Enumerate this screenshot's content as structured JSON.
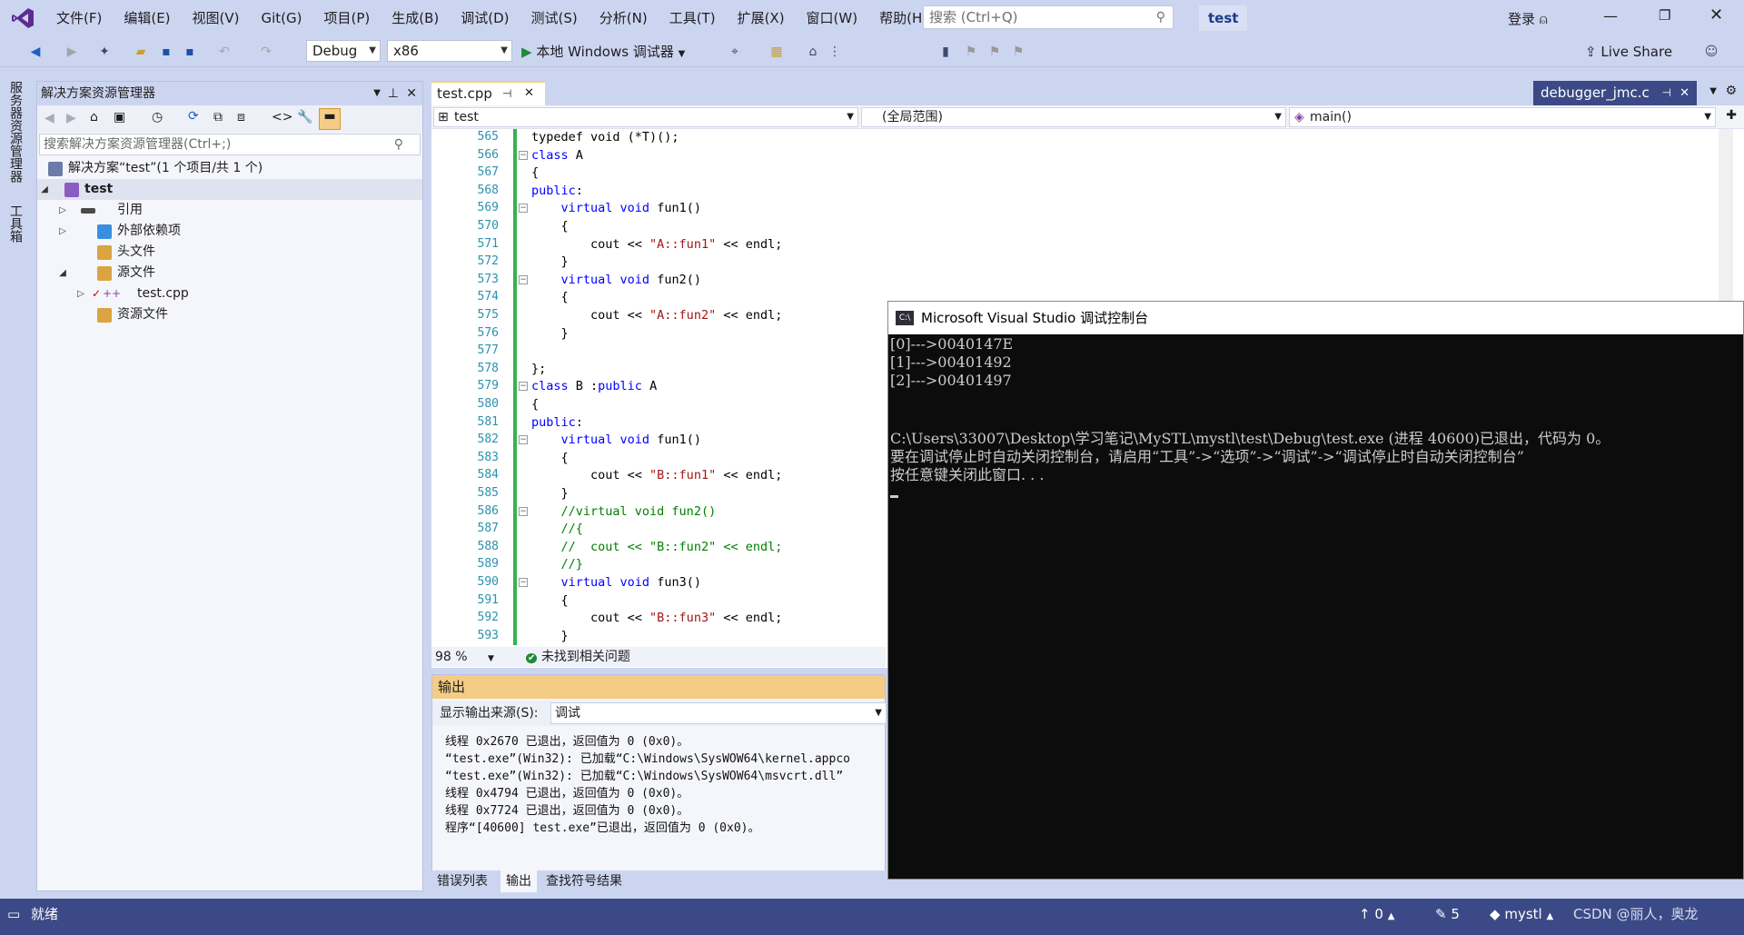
{
  "menu": [
    "文件(F)",
    "编辑(E)",
    "视图(V)",
    "Git(G)",
    "项目(P)",
    "生成(B)",
    "调试(D)",
    "测试(S)",
    "分析(N)",
    "工具(T)",
    "扩展(X)",
    "窗口(W)",
    "帮助(H)"
  ],
  "search_placeholder": "搜索 (Ctrl+Q)",
  "project_badge": "test",
  "login": "登录",
  "toolbar": {
    "config": "Debug",
    "platform": "x86",
    "run_label": "本地 Windows 调试器",
    "live_share": "Live Share"
  },
  "leftstrip": {
    "tab1": "服务器资源管理器",
    "tab2": "工具箱"
  },
  "solution": {
    "title": "解决方案资源管理器",
    "search_placeholder": "搜索解决方案资源管理器(Ctrl+;)",
    "root": "解决方案“test”(1 个项目/共 1 个)",
    "project": "test",
    "items": [
      "引用",
      "外部依赖项",
      "头文件",
      "源文件",
      "test.cpp",
      "资源文件"
    ]
  },
  "editor": {
    "tab": "test.cpp",
    "right_tab": "debugger_jmc.c",
    "nav_project": "test",
    "nav_scope": "(全局范围)",
    "nav_member": "main()",
    "zoom": "98 %",
    "issues": "未找到相关问题",
    "line_numbers": [
      "565",
      "566",
      "567",
      "568",
      "569",
      "570",
      "571",
      "572",
      "573",
      "574",
      "575",
      "576",
      "577",
      "578",
      "579",
      "580",
      "581",
      "582",
      "583",
      "584",
      "585",
      "586",
      "587",
      "588",
      "589",
      "590",
      "591",
      "592",
      "593"
    ]
  },
  "code": [
    [
      [
        "p",
        "typedef void (*T)();"
      ]
    ],
    [
      [
        "k",
        "class"
      ],
      [
        "p",
        " A"
      ]
    ],
    [
      [
        "p",
        "{"
      ]
    ],
    [
      [
        "k",
        "public"
      ],
      [
        "p",
        ":"
      ]
    ],
    [
      [
        "p",
        "    "
      ],
      [
        "k",
        "virtual void"
      ],
      [
        "p",
        " fun1()"
      ]
    ],
    [
      [
        "p",
        "    {"
      ]
    ],
    [
      [
        "p",
        "        cout << "
      ],
      [
        "s",
        "\"A::fun1\""
      ],
      [
        "p",
        " << endl;"
      ]
    ],
    [
      [
        "p",
        "    }"
      ]
    ],
    [
      [
        "p",
        "    "
      ],
      [
        "k",
        "virtual void"
      ],
      [
        "p",
        " fun2()"
      ]
    ],
    [
      [
        "p",
        "    {"
      ]
    ],
    [
      [
        "p",
        "        cout << "
      ],
      [
        "s",
        "\"A::fun2\""
      ],
      [
        "p",
        " << endl;"
      ]
    ],
    [
      [
        "p",
        "    }"
      ]
    ],
    [
      [
        "p",
        ""
      ]
    ],
    [
      [
        "p",
        "};"
      ]
    ],
    [
      [
        "k",
        "class"
      ],
      [
        "p",
        " B :"
      ],
      [
        "k",
        "public"
      ],
      [
        "p",
        " A"
      ]
    ],
    [
      [
        "p",
        "{"
      ]
    ],
    [
      [
        "k",
        "public"
      ],
      [
        "p",
        ":"
      ]
    ],
    [
      [
        "p",
        "    "
      ],
      [
        "k",
        "virtual void"
      ],
      [
        "p",
        " fun1()"
      ]
    ],
    [
      [
        "p",
        "    {"
      ]
    ],
    [
      [
        "p",
        "        cout << "
      ],
      [
        "s",
        "\"B::fun1\""
      ],
      [
        "p",
        " << endl;"
      ]
    ],
    [
      [
        "p",
        "    }"
      ]
    ],
    [
      [
        "p",
        "    "
      ],
      [
        "c",
        "//virtual void fun2()"
      ]
    ],
    [
      [
        "p",
        "    "
      ],
      [
        "c",
        "//{"
      ]
    ],
    [
      [
        "p",
        "    "
      ],
      [
        "c",
        "//  cout << \"B::fun2\" << endl;"
      ]
    ],
    [
      [
        "p",
        "    "
      ],
      [
        "c",
        "//}"
      ]
    ],
    [
      [
        "p",
        "    "
      ],
      [
        "k",
        "virtual void"
      ],
      [
        "p",
        " fun3()"
      ]
    ],
    [
      [
        "p",
        "    {"
      ]
    ],
    [
      [
        "p",
        "        cout << "
      ],
      [
        "s",
        "\"B::fun3\""
      ],
      [
        "p",
        " << endl;"
      ]
    ],
    [
      [
        "p",
        "    }"
      ]
    ]
  ],
  "output": {
    "title": "输出",
    "source_label": "显示输出来源(S):",
    "source_value": "调试",
    "lines": [
      "线程 0x2670 已退出，返回值为 0 (0x0)。",
      "“test.exe”(Win32): 已加载“C:\\Windows\\SysWOW64\\kernel.appco",
      "“test.exe”(Win32): 已加载“C:\\Windows\\SysWOW64\\msvcrt.dll”",
      "线程 0x4794 已退出，返回值为 0 (0x0)。",
      "线程 0x7724 已退出，返回值为 0 (0x0)。",
      "程序“[40600] test.exe”已退出，返回值为 0 (0x0)。"
    ],
    "tabs": [
      "错误列表",
      "输出",
      "查找符号结果"
    ]
  },
  "console": {
    "title": "Microsoft Visual Studio 调试控制台",
    "lines": [
      "[0]--->0040147E",
      "[1]--->00401492",
      "[2]--->00401497",
      "",
      "",
      "C:\\Users\\33007\\Desktop\\学习笔记\\MySTL\\mystl\\test\\Debug\\test.exe (进程 40600)已退出，代码为 0。",
      "要在调试停止时自动关闭控制台，请启用“工具”->“选项”->“调试”->“调试停止时自动关闭控制台”",
      "按任意键关闭此窗口. . ."
    ]
  },
  "status": {
    "ready": "就绪",
    "up_count": "0",
    "edit_count": "5",
    "repo": "mystl",
    "watermark": "CSDN @丽人，奥龙"
  }
}
